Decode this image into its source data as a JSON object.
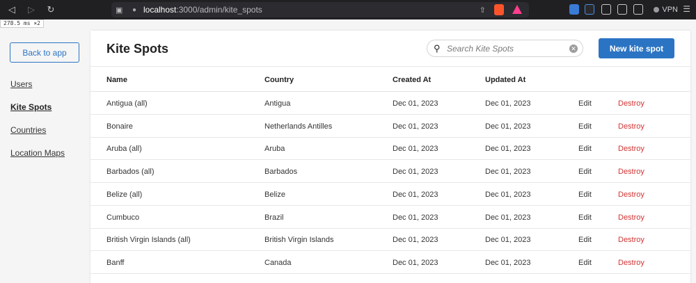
{
  "browser": {
    "url_host": "localhost",
    "url_path": ":3000/admin/kite_spots",
    "vpn_label": "VPN"
  },
  "timing": "278.5 ms ×2",
  "sidebar": {
    "back_label": "Back to app",
    "items": [
      {
        "label": "Users",
        "active": false
      },
      {
        "label": "Kite Spots",
        "active": true
      },
      {
        "label": "Countries",
        "active": false
      },
      {
        "label": "Location Maps",
        "active": false
      }
    ]
  },
  "main": {
    "title": "Kite Spots",
    "search_placeholder": "Search Kite Spots",
    "new_button": "New kite spot",
    "columns": [
      "Name",
      "Country",
      "Created At",
      "Updated At"
    ],
    "edit_label": "Edit",
    "destroy_label": "Destroy",
    "rows": [
      {
        "name": "Antigua (all)",
        "country": "Antigua",
        "created": "Dec 01, 2023",
        "updated": "Dec 01, 2023"
      },
      {
        "name": "Bonaire",
        "country": "Netherlands Antilles",
        "created": "Dec 01, 2023",
        "updated": "Dec 01, 2023"
      },
      {
        "name": "Aruba (all)",
        "country": "Aruba",
        "created": "Dec 01, 2023",
        "updated": "Dec 01, 2023"
      },
      {
        "name": "Barbados (all)",
        "country": "Barbados",
        "created": "Dec 01, 2023",
        "updated": "Dec 01, 2023"
      },
      {
        "name": "Belize (all)",
        "country": "Belize",
        "created": "Dec 01, 2023",
        "updated": "Dec 01, 2023"
      },
      {
        "name": "Cumbuco",
        "country": "Brazil",
        "created": "Dec 01, 2023",
        "updated": "Dec 01, 2023"
      },
      {
        "name": "British Virgin Islands (all)",
        "country": "British Virgin Islands",
        "created": "Dec 01, 2023",
        "updated": "Dec 01, 2023"
      },
      {
        "name": "Banff",
        "country": "Canada",
        "created": "Dec 01, 2023",
        "updated": "Dec 01, 2023"
      }
    ]
  }
}
